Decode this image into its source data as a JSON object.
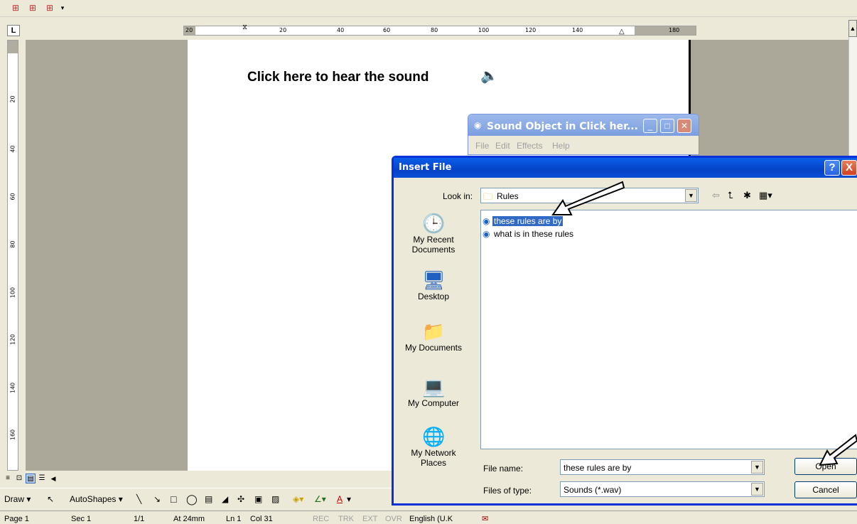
{
  "top_toolbar": {
    "icons": [
      "table-icon",
      "table-icon",
      "table-icon"
    ]
  },
  "ruler": {
    "tab_selector": "L",
    "h_ticks": [
      "20",
      "20",
      "40",
      "60",
      "80",
      "100",
      "120",
      "140",
      "180"
    ],
    "v_ticks": [
      "20",
      "40",
      "60",
      "80",
      "100",
      "120",
      "140",
      "160"
    ]
  },
  "document": {
    "heading": "Click here to hear the sound"
  },
  "sound_window": {
    "title": "Sound Object in Click her...",
    "menu": [
      "File",
      "Edit",
      "Effects",
      "Help"
    ]
  },
  "insert_dialog": {
    "title": "Insert File",
    "help_label": "?",
    "close_label": "X",
    "look_in_label": "Look in:",
    "look_in_value": "Rules",
    "places": [
      {
        "label": "My Recent Documents",
        "icon": "recent-documents-icon"
      },
      {
        "label": "Desktop",
        "icon": "desktop-icon"
      },
      {
        "label": "My Documents",
        "icon": "my-documents-icon"
      },
      {
        "label": "My Computer",
        "icon": "my-computer-icon"
      },
      {
        "label": "My Network Places",
        "icon": "network-places-icon"
      }
    ],
    "files": [
      {
        "name": "these rules are by",
        "selected": true
      },
      {
        "name": "what is in these rules",
        "selected": false
      }
    ],
    "file_name_label": "File name:",
    "file_name_value": "these rules are by",
    "files_of_type_label": "Files of type:",
    "files_of_type_value": "Sounds (*.wav)",
    "open_label": "Open",
    "cancel_label": "Cancel"
  },
  "draw_toolbar": {
    "draw_label": "Draw",
    "autoshapes_label": "AutoShapes"
  },
  "status_bar": {
    "page": "Page 1",
    "sec": "Sec 1",
    "pages": "1/1",
    "at": "At 24mm",
    "ln": "Ln 1",
    "col": "Col 31",
    "rec": "REC",
    "trk": "TRK",
    "ext": "EXT",
    "ovr": "OVR",
    "language": "English (U.K"
  }
}
